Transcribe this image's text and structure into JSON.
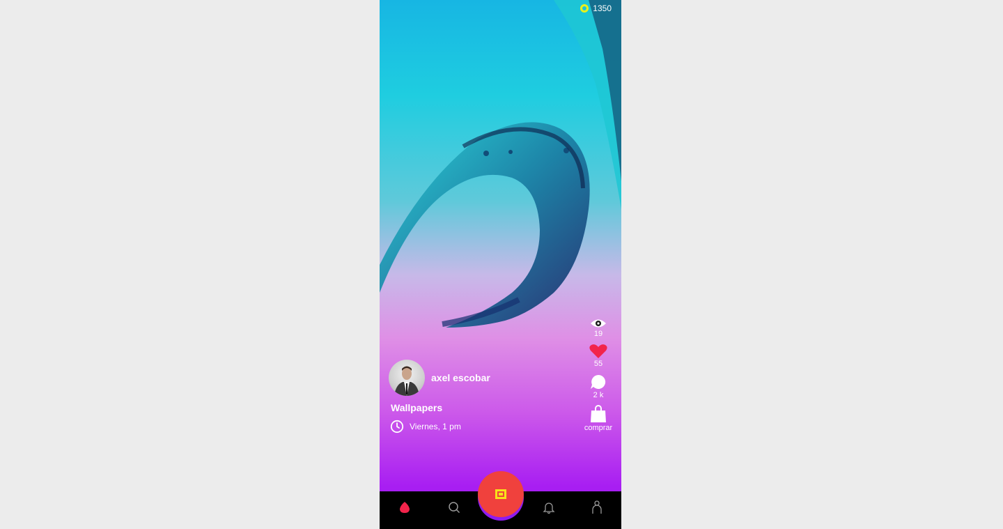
{
  "header": {
    "coins": "1350"
  },
  "stats": {
    "views": "19",
    "likes": "55",
    "comments": "2 k",
    "buy_label": "comprar"
  },
  "post": {
    "author": "axel escobar",
    "title": "Wallpapers",
    "schedule": "Viernes, 1 pm"
  },
  "nav": {
    "items": [
      "home-icon",
      "search-icon",
      "create-icon",
      "bell-icon",
      "profile-icon"
    ]
  },
  "colors": {
    "like": "#f2244b",
    "fab": "#f0413d",
    "fab_ring": "#8e1bf0",
    "coin": "#e8f11b",
    "navbar": "#000000"
  }
}
